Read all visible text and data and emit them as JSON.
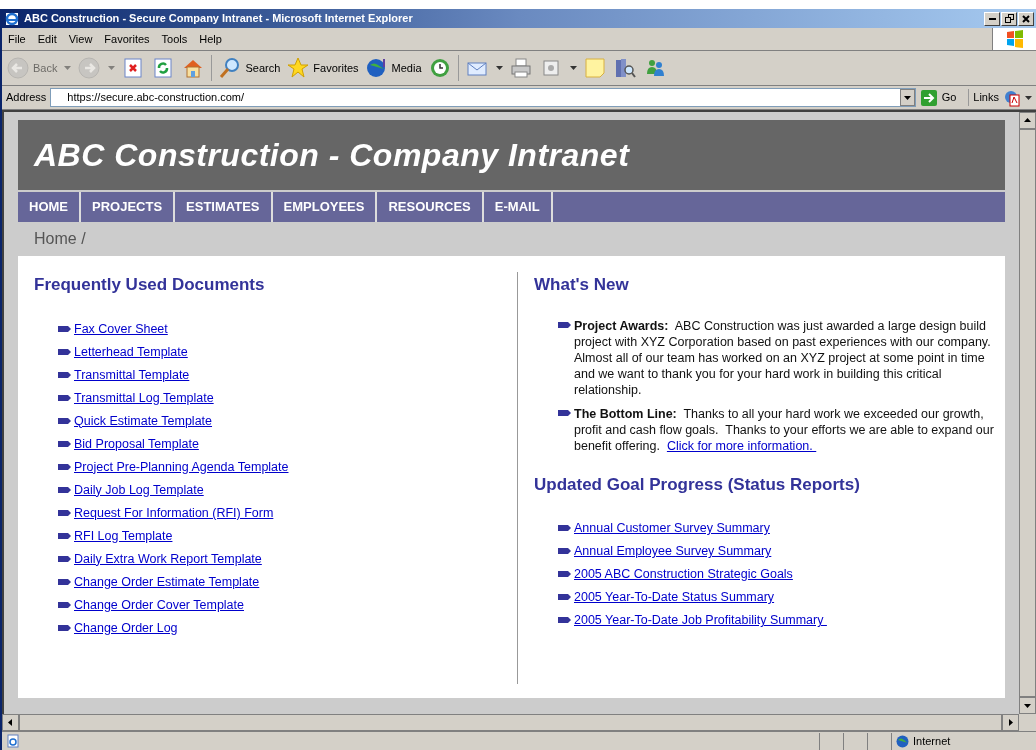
{
  "window": {
    "title": "ABC Construction - Secure Company Intranet - Microsoft Internet Explorer"
  },
  "menu": [
    "File",
    "Edit",
    "View",
    "Favorites",
    "Tools",
    "Help"
  ],
  "toolbar": [
    {
      "kind": "back",
      "label": "Back",
      "disabled": true,
      "dropdown": true
    },
    {
      "kind": "forward",
      "disabled": true,
      "dropdown": true
    },
    {
      "kind": "stop",
      "disabled": false,
      "dropdown": false
    },
    {
      "kind": "refresh",
      "disabled": false,
      "dropdown": false
    },
    {
      "kind": "home",
      "disabled": false,
      "dropdown": false
    },
    {
      "kind": "search",
      "label": "Search",
      "disabled": false,
      "dropdown": false
    },
    {
      "kind": "favorites",
      "label": "Favorites",
      "disabled": false,
      "dropdown": false
    },
    {
      "kind": "media",
      "label": "Media",
      "disabled": false,
      "dropdown": false
    },
    {
      "kind": "history",
      "disabled": false,
      "dropdown": false
    },
    {
      "kind": "mail",
      "disabled": false,
      "dropdown": true
    },
    {
      "kind": "print",
      "disabled": false,
      "dropdown": false
    },
    {
      "kind": "edit",
      "disabled": false,
      "dropdown": true
    },
    {
      "kind": "note",
      "disabled": false,
      "dropdown": false
    },
    {
      "kind": "research",
      "disabled": false,
      "dropdown": false
    },
    {
      "kind": "messenger",
      "disabled": false,
      "dropdown": false
    }
  ],
  "address": {
    "label": "Address",
    "value": "https://secure.abc-construction.com/",
    "go": "Go",
    "links": "Links"
  },
  "page": {
    "title": "ABC Construction - Company Intranet",
    "nav": [
      "HOME",
      "PROJECTS",
      "ESTIMATES",
      "EMPLOYEES",
      "RESOURCES",
      "E-MAIL"
    ],
    "breadcrumb": "Home /",
    "documents": {
      "heading": "Frequently Used Documents",
      "links": [
        "Fax Cover Sheet",
        "Letterhead Template",
        "Transmittal Template",
        "Transmittal Log Template",
        "Quick Estimate Template",
        "Bid Proposal Template",
        "Project Pre-Planning Agenda Template",
        "Daily Job Log Template",
        "Request For Information (RFI) Form",
        "RFI Log Template",
        "Daily Extra Work Report Template",
        "Change Order Estimate Template",
        "Change Order Cover Template",
        "Change Order Log"
      ]
    },
    "news": {
      "heading": "What's New",
      "items": [
        {
          "text": "**Project Awards:**  ABC Construction was just awarded a large design build project with XYZ Corporation based on past experiences with our company.  Almost all of our team has worked on an XYZ project at some point in time and we want to thank you for your hard work in building this critical relationship."
        },
        {
          "text": "**The Bottom Line:**  Thanks to all your hard work we exceeded our growth, profit and cash flow goals.  Thanks to your efforts we are able to expand our benefit offering.  ",
          "link": "Click for more information. "
        }
      ]
    },
    "goals": {
      "heading": "Updated Goal Progress (Status Reports)",
      "links": [
        "Annual Customer Survey Summary",
        "Annual Employee Survey Summary",
        "2005 ABC Construction Strategic Goals",
        "2005 Year-To-Date Status Summary",
        "2005 Year-To-Date Job Profitability Summary "
      ]
    }
  },
  "status_bar": {
    "zone": "Internet"
  }
}
